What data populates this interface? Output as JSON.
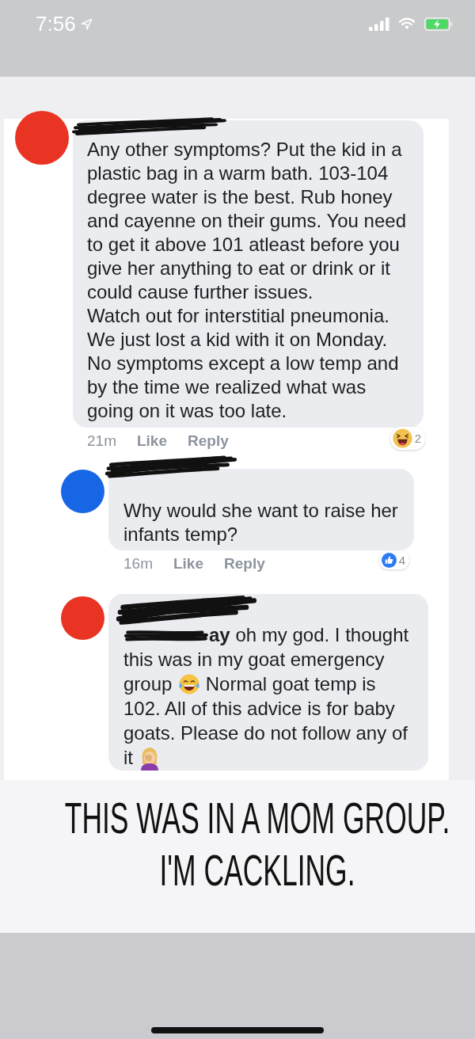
{
  "status_bar": {
    "time": "7:56"
  },
  "comments": [
    {
      "color": "#e93424",
      "name_redacted": true,
      "body": [
        {
          "kind": "text",
          "text": "Any other symptoms? Put the kid in a plastic bag in a warm bath. 103-104 degree water is the best. Rub honey and cayenne on their gums. You need to get it above 101 atleast before you give her anything to eat or drink or it could cause further issues.\nWatch out for interstitial pneumonia. We just lost a kid with it on Monday. No symptoms except a low temp and by the time we realized what was going on it was too late."
        }
      ],
      "time": "21m",
      "actions": [
        "Like",
        "Reply"
      ],
      "reaction": {
        "kind": "haha",
        "count": "2"
      },
      "replies": [
        {
          "color": "#1766e5",
          "name_redacted": true,
          "body": [
            {
              "kind": "text",
              "text": "Why would she want to raise her infants temp?"
            }
          ],
          "time": "16m",
          "actions": [
            "Like",
            "Reply"
          ],
          "reaction": {
            "kind": "like",
            "count": "4"
          }
        },
        {
          "color": "#e93424",
          "name_redacted": true,
          "body": [
            {
              "kind": "mention",
              "text": "ay"
            },
            {
              "kind": "text",
              "text": "oh my god. I thought this was in my goat emergency group"
            },
            {
              "kind": "laughing"
            },
            {
              "kind": "text",
              "text": "Normal goat temp is 102. All of this advice is for baby goats. Please do not follow any of it"
            },
            {
              "kind": "facepalm"
            }
          ]
        }
      ]
    }
  ],
  "caption": "THIS WAS IN A MOM GROUP. I'M CACKLING."
}
